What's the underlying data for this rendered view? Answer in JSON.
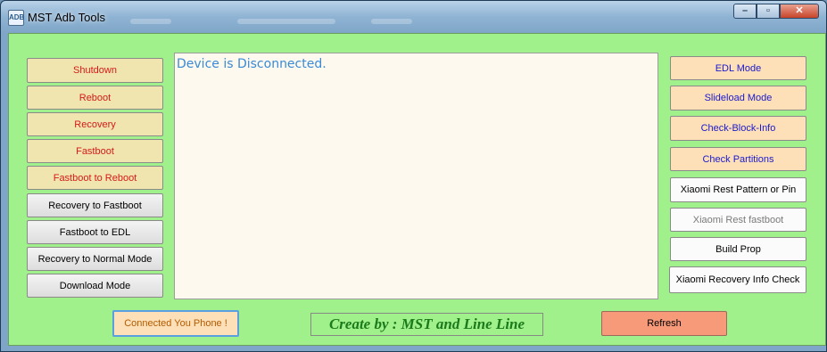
{
  "window": {
    "title": "MST Adb Tools",
    "icon": "app-icon"
  },
  "controls": {
    "minimize": "minimize-icon",
    "maximize": "maximize-icon",
    "close": "close-icon"
  },
  "left_buttons": [
    {
      "label": "Shutdown"
    },
    {
      "label": "Reboot"
    },
    {
      "label": "Recovery"
    },
    {
      "label": "Fastboot"
    },
    {
      "label": "Fastboot to Reboot"
    },
    {
      "label": "Recovery to Fastboot"
    },
    {
      "label": "Fastboot to EDL"
    },
    {
      "label": "Recovery to Normal Mode"
    },
    {
      "label": "Download Mode"
    }
  ],
  "log": {
    "text": "Device is Disconnected."
  },
  "right_buttons": [
    {
      "label": "EDL Mode"
    },
    {
      "label": "Slideload Mode"
    },
    {
      "label": "Check-Block-Info"
    },
    {
      "label": "Check Partitions"
    },
    {
      "label": "Xiaomi Rest Pattern or Pin"
    },
    {
      "label": "Xiaomi Rest fastboot",
      "enabled": false
    },
    {
      "label": "Build Prop"
    },
    {
      "label": "Xiaomi Recovery Info Check"
    }
  ],
  "footer": {
    "status_label": "Connected You Phone !",
    "credit": "Create by : MST and Line Line",
    "refresh_label": "Refresh"
  },
  "colors": {
    "client_bg": "#a0f08b",
    "red_text": "#d61a1a",
    "blue_text": "#1a1acc",
    "log_text": "#3a8ad6",
    "credit_text": "#1b7a1b",
    "refresh_bg": "#f79a7a"
  }
}
